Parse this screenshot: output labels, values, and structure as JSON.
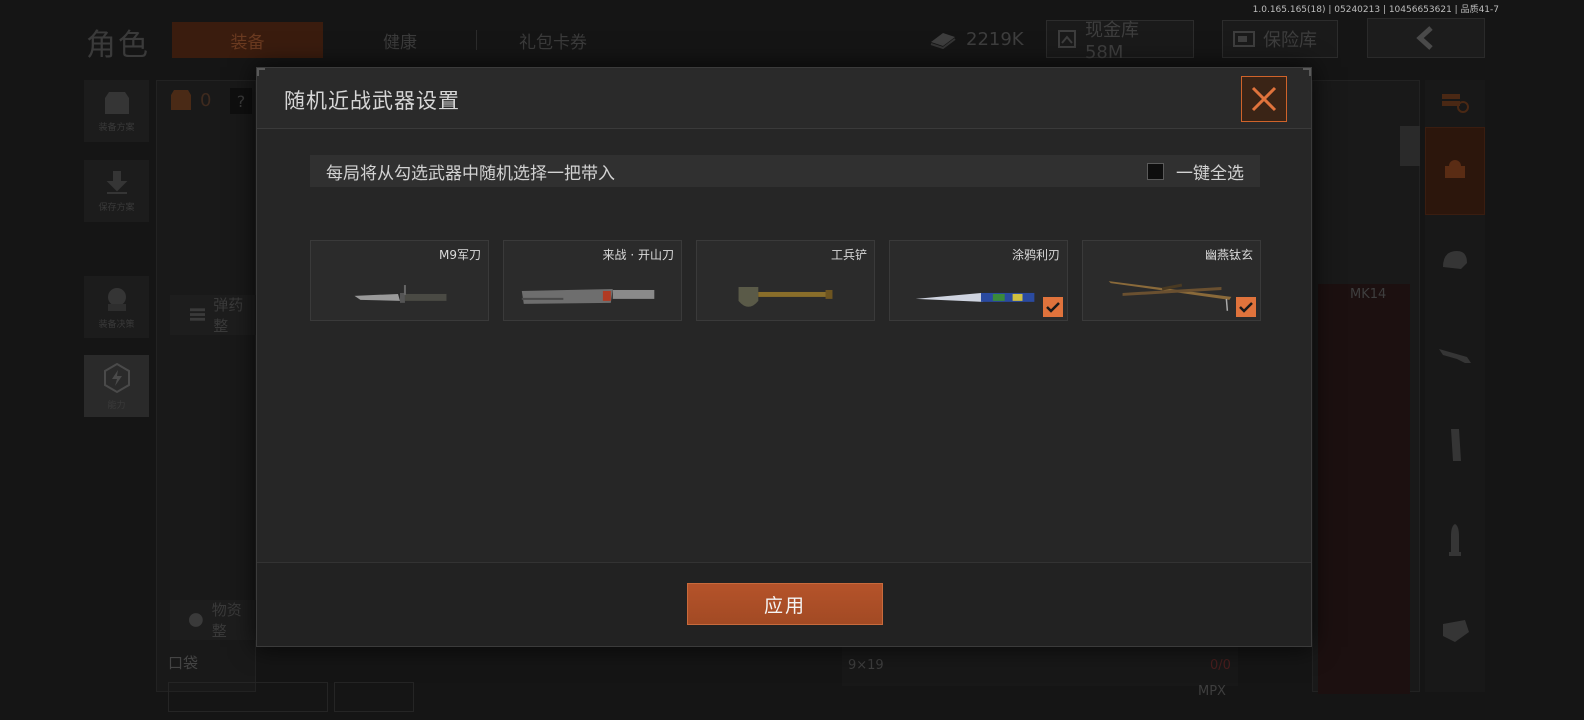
{
  "version_info": "1.0.165.165(18) | 05240213 | 10456653621 | 品质41-7",
  "background": {
    "title": "角色",
    "tabs": [
      "装备",
      "健康",
      "礼包卡券"
    ],
    "resources": {
      "money": "2219K",
      "cash_vault": "现金库 58M",
      "insurance": "保险库"
    },
    "left_nav": [
      "装备方案",
      "保存方案",
      "装备决策",
      "能力"
    ],
    "armor_count": "0",
    "help_mark": "?",
    "ammo_section": "弹药整",
    "supplies_section": "物资整",
    "pocket_label": "口袋",
    "weapon_label": "MK14",
    "ammo_caliber": "9×19",
    "ammo_count": "0/0",
    "bottom_weapon": "MPX"
  },
  "modal": {
    "title": "随机近战武器设置",
    "hint": "每局将从勾选武器中随机选择一把带入",
    "select_all": "一键全选",
    "weapons": [
      {
        "name": "M9军刀",
        "checked": false,
        "icon": "knife-icon"
      },
      {
        "name": "来战 · 开山刀",
        "checked": false,
        "icon": "machete-icon"
      },
      {
        "name": "工兵铲",
        "checked": false,
        "icon": "shovel-icon"
      },
      {
        "name": "涂鸦利刃",
        "checked": true,
        "icon": "graffiti-blade-icon"
      },
      {
        "name": "幽燕钛玄",
        "checked": true,
        "icon": "twin-blade-icon"
      }
    ],
    "apply": "应用"
  },
  "colors": {
    "accent": "#e0733c",
    "apply_button": "#aa4e27",
    "modal_bg": "#262626",
    "page_bg": "#151515"
  }
}
